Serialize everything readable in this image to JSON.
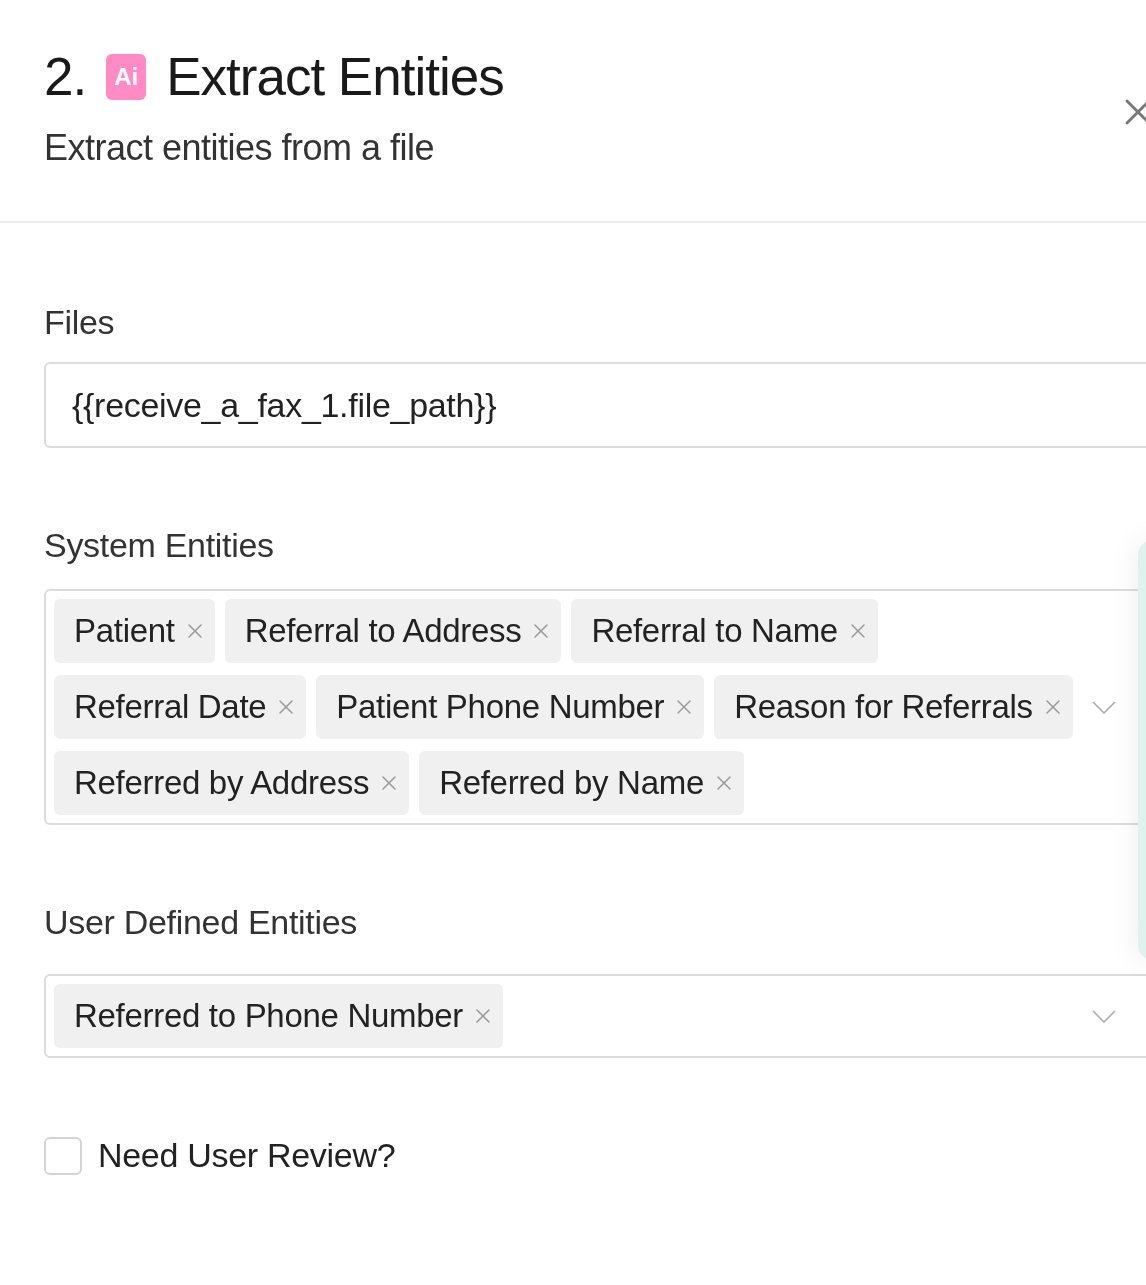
{
  "header": {
    "step": "2.",
    "badge": "Ai",
    "title": "Extract Entities",
    "subtitle": "Extract entities from a file"
  },
  "files": {
    "label": "Files",
    "value": "{{receive_a_fax_1.file_path}}"
  },
  "system_entities": {
    "label": "System Entities",
    "rows": [
      {
        "tags": [
          {
            "label": "Patient"
          },
          {
            "label": "Referral to Address"
          },
          {
            "label": "Referral to Name"
          }
        ]
      },
      {
        "tags": [
          {
            "label": "Referral Date"
          },
          {
            "label": "Patient Phone Number"
          },
          {
            "label": "Reason for Referrals"
          }
        ]
      },
      {
        "tags": [
          {
            "label": "Referred by Address"
          },
          {
            "label": "Referred by Name"
          }
        ]
      }
    ]
  },
  "user_defined_entities": {
    "label": "User Defined Entities",
    "rows": [
      {
        "tags": [
          {
            "label": "Referred to Phone Number"
          }
        ]
      }
    ]
  },
  "review": {
    "label": "Need User Review?",
    "checked": false
  }
}
